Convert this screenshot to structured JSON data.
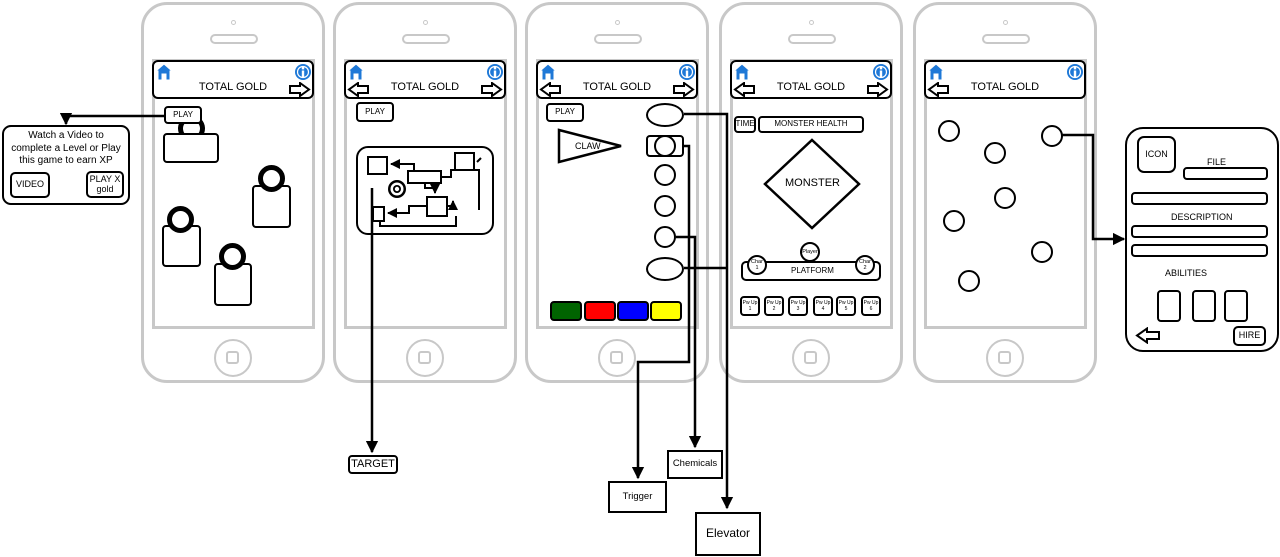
{
  "header": {
    "title": "TOTAL GOLD",
    "home_icon": "home-icon",
    "info_icon": "info-icon",
    "back_icon": "arrow-left-icon",
    "next_icon": "arrow-right-icon"
  },
  "popup": {
    "text": "Watch a Video to complete a Level or Play this game to earn XP",
    "video_label": "VIDEO",
    "play_label": "PLAY X gold"
  },
  "screen1": {
    "play_label": "PLAY"
  },
  "screen2": {
    "play_label": "PLAY",
    "target_label": "TARGET"
  },
  "screen3": {
    "play_label": "PLAY",
    "claw_label": "CLAW",
    "color_buttons": [
      {
        "name": "green",
        "color": "#006400"
      },
      {
        "name": "red",
        "color": "#ff0000"
      },
      {
        "name": "blue",
        "color": "#0000ff"
      },
      {
        "name": "yellow",
        "color": "#ffff00"
      }
    ],
    "trigger_label": "Trigger",
    "chemicals_label": "Chemicals",
    "elevator_label": "Elevator"
  },
  "screen4": {
    "time_label": "TIME",
    "health_label": "MONSTER HEALTH",
    "monster_label": "MONSTER",
    "player_label": "Player",
    "char1_label": "Char 1",
    "char2_label": "Char 2",
    "platform_label": "PLATFORM",
    "powerups": [
      "Pw Up 1",
      "Pw Up 2",
      "Pw Up 3",
      "Pw Up 4",
      "Pw Up 5",
      "Pw Up 6"
    ]
  },
  "detail": {
    "icon_label": "ICON",
    "file_label": "FILE",
    "description_label": "DESCRIPTION",
    "abilities_label": "ABILITIES",
    "hire_label": "HIRE"
  },
  "colors": {
    "accent_blue": "#1e78d7",
    "frame_gray": "#c8c8c8"
  }
}
